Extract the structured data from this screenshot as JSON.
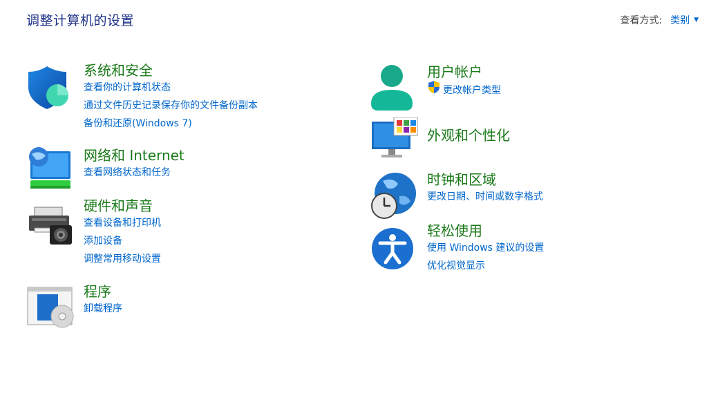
{
  "header": {
    "title": "调整计算机的设置",
    "view_by_label": "查看方式:",
    "view_by_value": "类别"
  },
  "categories": [
    {
      "heading": "系统和安全",
      "links": [
        "查看你的计算机状态",
        "通过文件历史记录保存你的文件备份副本",
        "备份和还原(Windows 7)"
      ],
      "icon": "shield-icon"
    },
    {
      "heading": "网络和 Internet",
      "links": [
        "查看网络状态和任务"
      ],
      "icon": "network-icon"
    },
    {
      "heading": "硬件和声音",
      "links": [
        "查看设备和打印机",
        "添加设备",
        "调整常用移动设置"
      ],
      "icon": "printer-icon"
    },
    {
      "heading": "程序",
      "links": [
        "卸载程序"
      ],
      "icon": "programs-icon"
    },
    {
      "heading": "用户帐户",
      "links": [
        "更改帐户类型"
      ],
      "icon": "user-icon"
    },
    {
      "heading": "外观和个性化",
      "links": [],
      "icon": "monitor-icon"
    },
    {
      "heading": "时钟和区域",
      "links": [
        "更改日期、时间或数字格式"
      ],
      "icon": "clock-globe-icon"
    },
    {
      "heading": "轻松使用",
      "links": [
        "使用 Windows 建议的设置",
        "优化视觉显示"
      ],
      "icon": "accessibility-icon"
    }
  ],
  "colors": {
    "heading": "#1a7a1a",
    "link": "#0066cc",
    "title": "#1e3287"
  }
}
